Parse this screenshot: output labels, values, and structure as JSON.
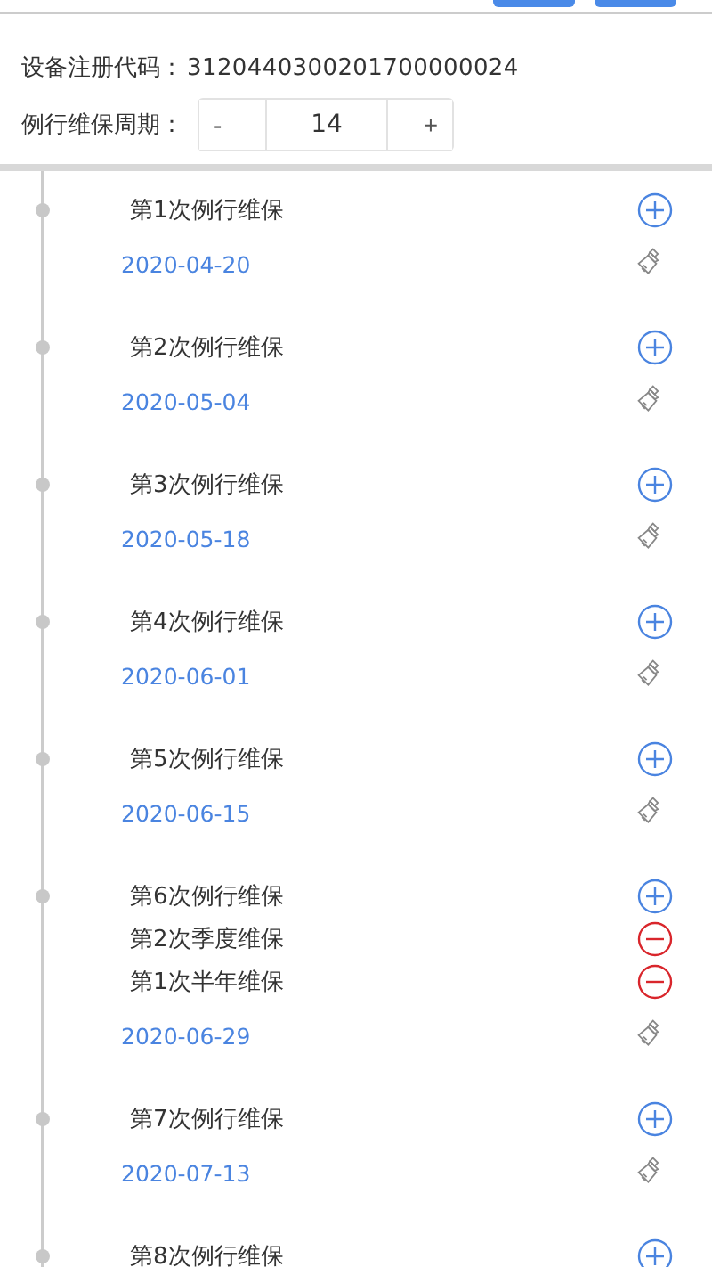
{
  "device": {
    "label": "设备注册代码：",
    "value": "3120440300201700000024"
  },
  "cycle": {
    "label": "例行维保周期：",
    "minus": "-",
    "value": "14",
    "plus": "+"
  },
  "items": [
    {
      "entries": [
        {
          "text": "第1次例行维保",
          "kind": "add"
        }
      ],
      "date": "2020-04-20"
    },
    {
      "entries": [
        {
          "text": "第2次例行维保",
          "kind": "add"
        }
      ],
      "date": "2020-05-04"
    },
    {
      "entries": [
        {
          "text": "第3次例行维保",
          "kind": "add"
        }
      ],
      "date": "2020-05-18"
    },
    {
      "entries": [
        {
          "text": "第4次例行维保",
          "kind": "add"
        }
      ],
      "date": "2020-06-01"
    },
    {
      "entries": [
        {
          "text": "第5次例行维保",
          "kind": "add"
        }
      ],
      "date": "2020-06-15"
    },
    {
      "entries": [
        {
          "text": "第6次例行维保",
          "kind": "add"
        },
        {
          "text": "第2次季度维保",
          "kind": "remove"
        },
        {
          "text": "第1次半年维保",
          "kind": "remove"
        }
      ],
      "date": "2020-06-29"
    },
    {
      "entries": [
        {
          "text": "第7次例行维保",
          "kind": "add"
        }
      ],
      "date": "2020-07-13"
    },
    {
      "entries": [
        {
          "text": "第8次例行维保",
          "kind": "add"
        }
      ]
    }
  ]
}
